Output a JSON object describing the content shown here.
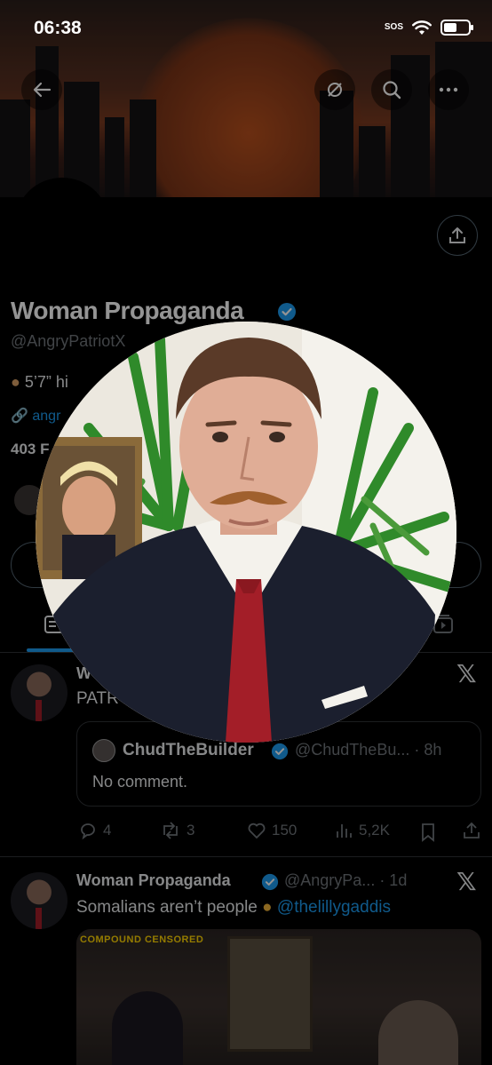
{
  "status_bar": {
    "time": "06:38",
    "sos": "SOS"
  },
  "profile": {
    "display_name": "Woman Propaganda",
    "handle": "@AngryPatriotX",
    "bio_partial": "5’7” hi",
    "link_partial": "angr",
    "following_partial": "403 F"
  },
  "posts": [
    {
      "author_partial": "W",
      "text_partial": "PATR",
      "quote": {
        "author": "ChudTheBuilder",
        "handle_time": "@ChudTheBu... · 8h",
        "text": "No comment."
      },
      "actions": {
        "replies": "4",
        "reposts": "3",
        "likes": "150",
        "views": "5,2K"
      }
    },
    {
      "author": "Woman Propaganda",
      "handle_time": "@AngryPa... · 1d",
      "text": "Somalians aren’t people",
      "mention": "@thelillygaddis",
      "media_title": "COMPOUND CENSORED"
    }
  ],
  "colors": {
    "accent": "#1d9bf0",
    "background": "#000000",
    "muted_text": "#71767b",
    "tie": "#a31e28",
    "suit": "#1b1f2e"
  }
}
